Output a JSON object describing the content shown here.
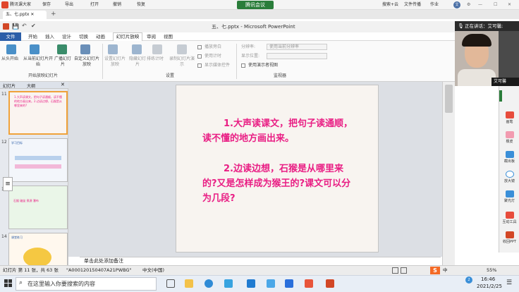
{
  "browser": {
    "app_name": "腾讯课大家",
    "toolbar": [
      "保存",
      "导出",
      "打开",
      "撤销",
      "恢复"
    ],
    "tencent_meeting": "腾讯会议",
    "right_links": [
      "搜索+云",
      "文件传播",
      "作业"
    ],
    "user_initial": "艾"
  },
  "ppt": {
    "window_title": "五、七.pptx - Microsoft PowerPoint",
    "menu": [
      "文件",
      "开始",
      "插入",
      "设计",
      "切换",
      "动画",
      "幻灯片放映",
      "审阅",
      "视图"
    ],
    "active_tab": "幻灯片放映",
    "ribbon": {
      "start_show": {
        "buttons": [
          "从头开始",
          "从当前幻灯片开始",
          "广播幻灯片",
          "自定义幻灯片放映"
        ],
        "group": "开始放映幻灯片"
      },
      "setup": {
        "buttons": [
          "设置幻灯片放映",
          "隐藏幻灯片",
          "排练计时",
          "录制幻灯片演示"
        ],
        "checkboxes": [
          "播放旁白",
          "使用计时",
          "显示媒体控件"
        ],
        "group": "设置"
      },
      "monitors": {
        "resolution_label": "分辨率:",
        "resolution_value": "使用当前分辨率",
        "show_on_label": "显示位置:",
        "presenter_view": "使用演示者视图",
        "group": "监视器"
      }
    },
    "pane_tabs": [
      "幻灯片",
      "大纲"
    ],
    "thumbnails": [
      {
        "num": "11",
        "text": "1.大声读课文，把句子读通顺，读不懂的地方画出来。2.边读边想，石猴是从哪里来的?"
      },
      {
        "num": "12",
        "text": "学习目标"
      },
      {
        "num": "13",
        "text": "石猴 破绽 泉源 瀑布"
      },
      {
        "num": "14",
        "text": "课堂练习"
      }
    ],
    "slide": {
      "paragraph1": "1.大声读课文，把句子读通顺，读不懂的地方画出来。",
      "paragraph2": "2.边读边想，石猴是从哪里来的?又是怎样成为猴王的?课文可以分为几段?"
    },
    "notes_placeholder": "单击此处添加备注",
    "status": {
      "slide_info": "幻灯片 第 11 张，共 63 张",
      "theme": "\"A000120150407A21PWBG\"",
      "language": "中文(中国)",
      "zoom": "55%"
    }
  },
  "meeting": {
    "speaking_label": "正在讲话：艾可馨;",
    "participant_name": "艾可馨",
    "tools": [
      "画笔",
      "橡皮",
      "截出板",
      "放大镜",
      "聚光灯",
      "互动工具",
      "收回PPT"
    ]
  },
  "taskbar": {
    "search_placeholder": "在这里输入你要搜索的内容",
    "time": "16:46",
    "date": "2021/2/25",
    "ime": "中",
    "notifications": "2"
  },
  "colors": {
    "accent_pink": "#e91e84",
    "ribbon_blue": "#2c5ea8",
    "tencent_green": "#2a7d3a"
  }
}
